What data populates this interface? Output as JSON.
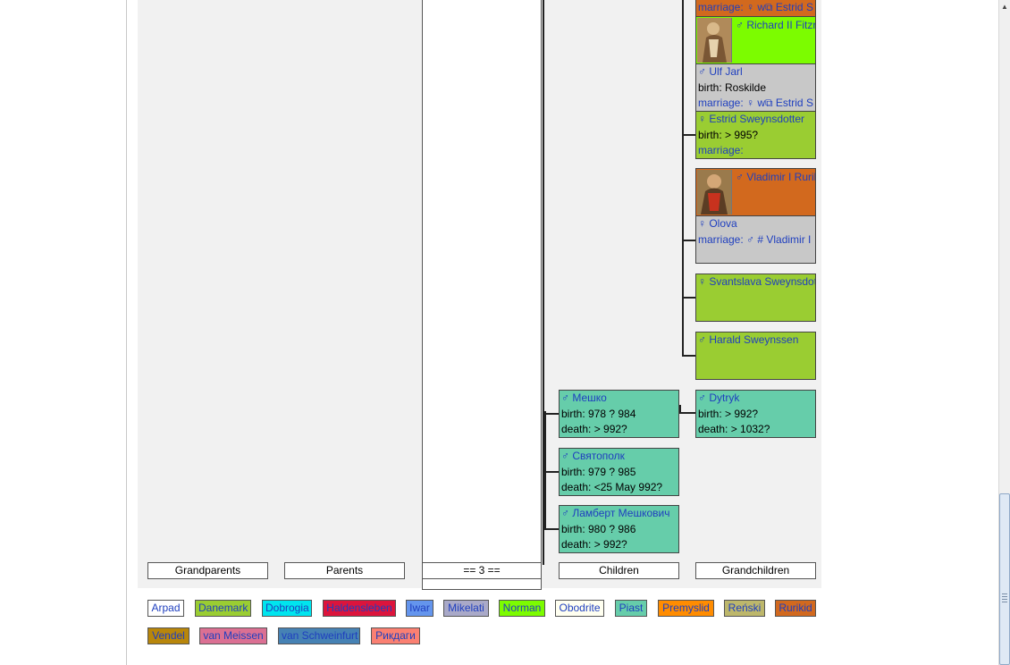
{
  "colors": {
    "danemark": "#9acd32",
    "norman": "#7cfc00",
    "neutral": "#c8c8c8",
    "rurikid": "#d2691e",
    "piast": "#66cdaa",
    "link": "#1f3fbf"
  },
  "icons": {
    "male": "male-symbol-icon",
    "female": "female-symbol-icon",
    "external": "external-link-icon"
  },
  "symbols": {
    "male": "♂",
    "female": "♀",
    "ext": "⧉"
  },
  "grandchildren": [
    {
      "rows": [
        {
          "label": "marriage:",
          "link": "♀ w⧉ Estrid S"
        }
      ]
    },
    {
      "name": "♂ Richard II Fitzr"
    },
    {
      "name": "♂ Ulf Jarl",
      "rows": [
        {
          "label": "birth: Roskilde"
        },
        {
          "label": "marriage:",
          "link": "♀ w⧉ Estrid S"
        }
      ]
    },
    {
      "name": "♀ Estrid Sweynsdotter",
      "rows": [
        {
          "label": "birth: > 995?"
        },
        {
          "label": "marriage:"
        }
      ]
    },
    {
      "name": "♂ Vladimir I Rurik"
    },
    {
      "name": "♀ Olova",
      "rows": [
        {
          "label": "marriage:",
          "link": "♂ # Vladimir I"
        }
      ]
    },
    {
      "name": "♀ Svantslava Sweynsdot"
    },
    {
      "name": "♂ Harald Sweynssen"
    },
    {
      "name": "♂ Dytryk",
      "rows": [
        {
          "label": "birth: > 992?"
        },
        {
          "label": "death: > 1032?"
        }
      ]
    }
  ],
  "children": [
    {
      "name": "♂ Мешко",
      "rows": [
        {
          "label": "birth: 978 ? 984"
        },
        {
          "label": "death: > 992?"
        }
      ]
    },
    {
      "name": "♂ Святополк",
      "rows": [
        {
          "label": "birth: 979 ? 985"
        },
        {
          "label": "death: <25 May 992?"
        }
      ]
    },
    {
      "name": "♂ Ламберт Мешкович",
      "rows": [
        {
          "label": "birth: 980 ? 986"
        },
        {
          "label": "death: > 992?"
        }
      ]
    }
  ],
  "headers": {
    "grandparents": "Grandparents",
    "parents": "Parents",
    "generation": "== 3 ==",
    "children": "Children",
    "grandchildren": "Grandchildren"
  },
  "legend": [
    {
      "label": "Arpad",
      "bg": "#ffffff",
      "fg": "#1f3fbf"
    },
    {
      "label": "Danemark",
      "bg": "#9acd32",
      "fg": "#1f3fbf"
    },
    {
      "label": "Dobrogia",
      "bg": "#00e5ee",
      "fg": "#1f3fbf"
    },
    {
      "label": "Haldensleben",
      "bg": "#dc143c",
      "fg": "#1f3fbf"
    },
    {
      "label": "Iwar",
      "bg": "#6495ed",
      "fg": "#1f3fbf"
    },
    {
      "label": "Mikelati",
      "bg": "#a9a9c8",
      "fg": "#1f3fbf"
    },
    {
      "label": "Norman",
      "bg": "#7cfc00",
      "fg": "#1f3fbf"
    },
    {
      "label": "Obodrite",
      "bg": "#fffff0",
      "fg": "#1f3fbf"
    },
    {
      "label": "Piast",
      "bg": "#66cdaa",
      "fg": "#1f3fbf"
    },
    {
      "label": "Premyslid",
      "bg": "#ff8c00",
      "fg": "#1f3fbf"
    },
    {
      "label": "Reński",
      "bg": "#bdb76b",
      "fg": "#1f3fbf"
    },
    {
      "label": "Rurikid",
      "bg": "#d2691e",
      "fg": "#1f3fbf"
    },
    {
      "label": "Vendel",
      "bg": "#b8860b",
      "fg": "#1f3fbf"
    },
    {
      "label": "van Meissen",
      "bg": "#db7093",
      "fg": "#1f3fbf"
    },
    {
      "label": "van Schweinfurt",
      "bg": "#4682b4",
      "fg": "#1f3fbf"
    },
    {
      "label": "Рикдаги",
      "bg": "#fa8072",
      "fg": "#1f3fbf"
    }
  ]
}
